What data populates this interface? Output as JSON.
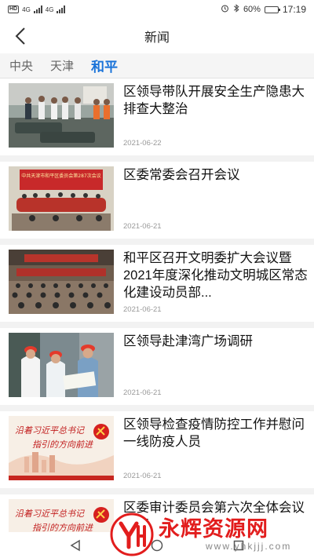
{
  "status_bar": {
    "battery_percent": "60%",
    "battery_level": 0.6,
    "time": "17:19",
    "network_badge": "HD",
    "network_type": "4G",
    "icons": [
      "alarm-icon",
      "bluetooth-icon",
      "battery-icon"
    ]
  },
  "nav": {
    "title": "新闻",
    "back_icon": "back-arrow-icon"
  },
  "tabs": [
    {
      "label": "中央",
      "active": false
    },
    {
      "label": "天津",
      "active": false
    },
    {
      "label": "和平",
      "active": true
    }
  ],
  "accent_color": "#1a73d9",
  "news": [
    {
      "title": "区领导带队开展安全生产隐患大排查大整治",
      "date": "2021-06-22",
      "thumb": "inspection-photo"
    },
    {
      "title": "区委常委会召开会议",
      "date": "2021-06-21",
      "thumb": "meeting-photo",
      "banner": "中共天津市和平区委员会第287次会议"
    },
    {
      "title": "和平区召开文明委扩大会议暨2021年度深化推动文明城区常态化建设动员部...",
      "date": "2021-06-21",
      "thumb": "conference-hall-photo"
    },
    {
      "title": "区领导赴津湾广场调研",
      "date": "2021-06-21",
      "thumb": "hardhat-survey-photo"
    },
    {
      "title": "区领导检查疫情防控工作并慰问一线防疫人员",
      "date": "2021-06-21",
      "thumb": "slogan-poster",
      "poster_line1": "沿着习近平总书记",
      "poster_line2": "指引的方向前进"
    },
    {
      "title": "区委审计委员会第六次全体会议召开",
      "date": "",
      "thumb": "slogan-poster",
      "poster_line1": "沿着习近平总书记",
      "poster_line2": "指引的方向前进"
    }
  ],
  "watermark": {
    "title": "永辉资源网",
    "url": "www.yhkjjj.com"
  },
  "system_nav": [
    "back-triangle-icon",
    "home-circle-icon",
    "recent-square-icon"
  ]
}
